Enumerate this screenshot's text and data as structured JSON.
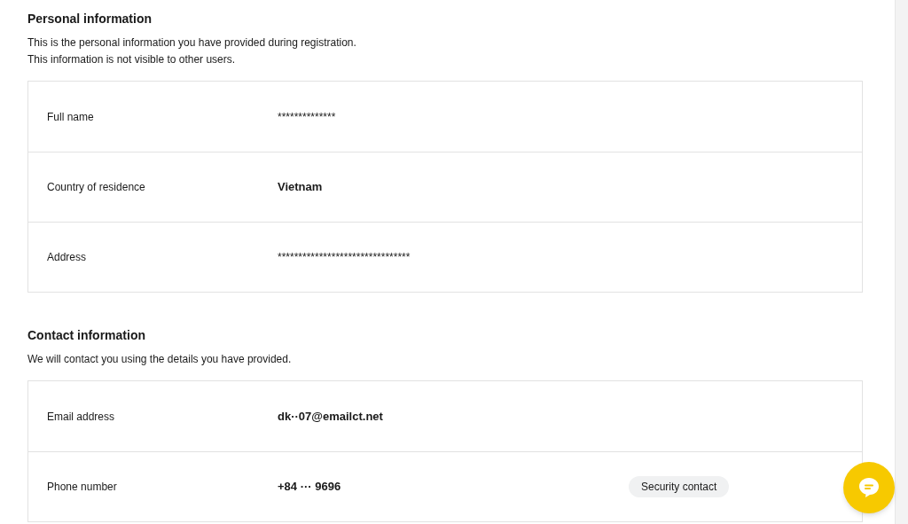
{
  "sections": [
    {
      "title": "Personal information",
      "description": [
        "This is the personal information you have provided during registration.",
        "This information is not visible to other users."
      ],
      "rows": [
        {
          "label": "Full name",
          "value": "**************",
          "emphasized": false
        },
        {
          "label": "Country of residence",
          "value": "Vietnam",
          "emphasized": true
        },
        {
          "label": "Address",
          "value": "********************************",
          "emphasized": false
        }
      ]
    },
    {
      "title": "Contact information",
      "description": [
        "We will contact you using the details you have provided."
      ],
      "rows": [
        {
          "label": "Email address",
          "value": "dk··07@emailct.net",
          "emphasized": true
        },
        {
          "label": "Phone number",
          "value": "+84 ··· 9696",
          "emphasized": true,
          "badge": "Security contact"
        }
      ]
    }
  ]
}
